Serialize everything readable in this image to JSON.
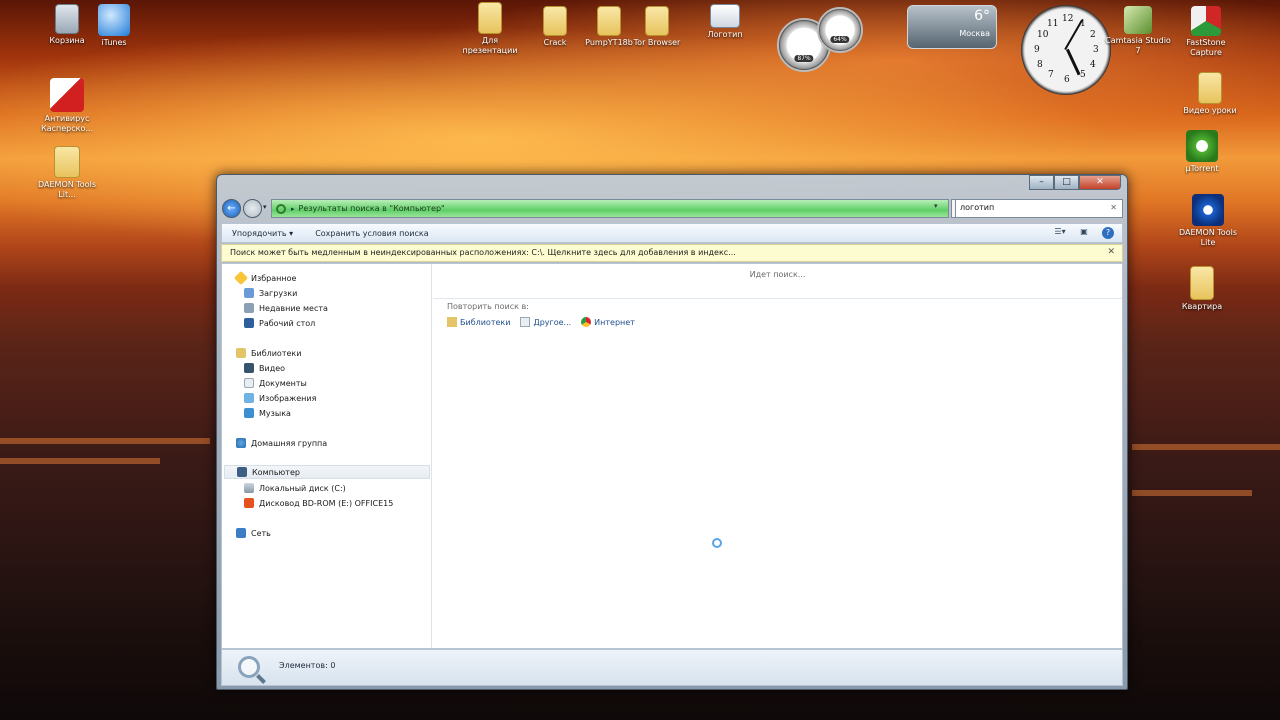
{
  "desktop": {
    "left_icons": [
      {
        "name": "recycle-bin",
        "label": "Корзина"
      },
      {
        "name": "itunes",
        "label": "iTunes"
      },
      {
        "name": "kaspersky",
        "label": "Антивирус Касперско..."
      },
      {
        "name": "daemon-tools-left",
        "label": "DAEMON Tools Lit..."
      }
    ],
    "top_icons": [
      {
        "name": "folder-presentation",
        "label": "Для презентации"
      },
      {
        "name": "folder-crack",
        "label": "Crack"
      },
      {
        "name": "folder-pumpyt",
        "label": "PumpYT18b"
      },
      {
        "name": "folder-tor",
        "label": "Tor Browser"
      },
      {
        "name": "logo-file",
        "label": "Логотип"
      }
    ],
    "right_icons": [
      {
        "name": "camtasia",
        "label": "Camtasia Studio 7"
      },
      {
        "name": "faststone",
        "label": "FastStone Capture"
      },
      {
        "name": "folder-video-lessons",
        "label": "Видео уроки"
      },
      {
        "name": "utorrent",
        "label": "µTorrent"
      },
      {
        "name": "daemon-tools-right",
        "label": "DAEMON Tools Lite"
      },
      {
        "name": "folder-apartment",
        "label": "Квартира"
      }
    ],
    "gadgets": {
      "cpu_gauge": "87%",
      "ram_gauge": "64%",
      "weather": {
        "temp": "6°",
        "city": "Москва"
      }
    }
  },
  "window": {
    "caption": {
      "min": "–",
      "max": "□",
      "close": "✕"
    },
    "address": {
      "path": "Результаты поиска в \"Компьютер\""
    },
    "search": {
      "value": "логотип"
    },
    "toolbar": {
      "organize": "Упорядочить ▾",
      "save_search": "Сохранить условия поиска"
    },
    "infobar": "Поиск может быть медленным в неиндексированных расположениях: C:\\. Щелкните здесь для добавления в индекс...",
    "nav": {
      "favorites": "Избранное",
      "downloads": "Загрузки",
      "recent": "Недавние места",
      "desktop": "Рабочий стол",
      "libraries": "Библиотеки",
      "video": "Видео",
      "documents": "Документы",
      "images": "Изображения",
      "music": "Музыка",
      "homegroup": "Домашняя группа",
      "computer": "Компьютер",
      "local_disk": "Локальный диск (C:)",
      "bd_rom": "Дисковод BD-ROM (E:) OFFICE15",
      "network": "Сеть"
    },
    "results": {
      "status": "Идет поиск...",
      "repeat_label": "Повторить поиск в:",
      "links": {
        "libraries": "Библиотеки",
        "other": "Другое...",
        "internet": "Интернет"
      }
    },
    "statusbar": {
      "count": "Элементов: 0"
    }
  }
}
